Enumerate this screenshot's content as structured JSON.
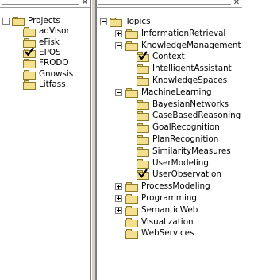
{
  "projects_panel": {
    "close_glyph": "✕",
    "root": {
      "label": "Projects",
      "expanded": true
    },
    "items": [
      {
        "label": "adVisor",
        "checked": false
      },
      {
        "label": "eFisk",
        "checked": false
      },
      {
        "label": "EPOS",
        "checked": true
      },
      {
        "label": "FRODO",
        "checked": false
      },
      {
        "label": "Gnowsis",
        "checked": false
      },
      {
        "label": "Litfass",
        "checked": false
      }
    ]
  },
  "topics_panel": {
    "close_glyph": "✕",
    "root": {
      "label": "Topics",
      "expanded": true
    },
    "items": [
      {
        "label": "InformationRetrieval",
        "level": 1,
        "expander": "plus",
        "checked": false
      },
      {
        "label": "KnowledgeManagement",
        "level": 1,
        "expander": "minus",
        "checked": false
      },
      {
        "label": "Context",
        "level": 2,
        "expander": "none",
        "checked": true
      },
      {
        "label": "IntelligentAssistant",
        "level": 2,
        "expander": "none",
        "checked": false
      },
      {
        "label": "KnowledgeSpaces",
        "level": 2,
        "expander": "none",
        "checked": false
      },
      {
        "label": "MachineLearning",
        "level": 1,
        "expander": "minus",
        "checked": false
      },
      {
        "label": "BayesianNetworks",
        "level": 2,
        "expander": "none",
        "checked": false
      },
      {
        "label": "CaseBasedReasoning",
        "level": 2,
        "expander": "none",
        "checked": false
      },
      {
        "label": "GoalRecognition",
        "level": 2,
        "expander": "none",
        "checked": false
      },
      {
        "label": "PlanRecognition",
        "level": 2,
        "expander": "none",
        "checked": false
      },
      {
        "label": "SimilarityMeasures",
        "level": 2,
        "expander": "none",
        "checked": false
      },
      {
        "label": "UserModeling",
        "level": 2,
        "expander": "none",
        "checked": false
      },
      {
        "label": "UserObservation",
        "level": 2,
        "expander": "none",
        "checked": true
      },
      {
        "label": "ProcessModeling",
        "level": 1,
        "expander": "plus",
        "checked": false
      },
      {
        "label": "Programming",
        "level": 1,
        "expander": "plus",
        "checked": false
      },
      {
        "label": "SemanticWeb",
        "level": 1,
        "expander": "plus",
        "checked": false
      },
      {
        "label": "Visualization",
        "level": 1,
        "expander": "none",
        "checked": false
      },
      {
        "label": "WebServices",
        "level": 1,
        "expander": "none",
        "checked": false
      }
    ]
  }
}
